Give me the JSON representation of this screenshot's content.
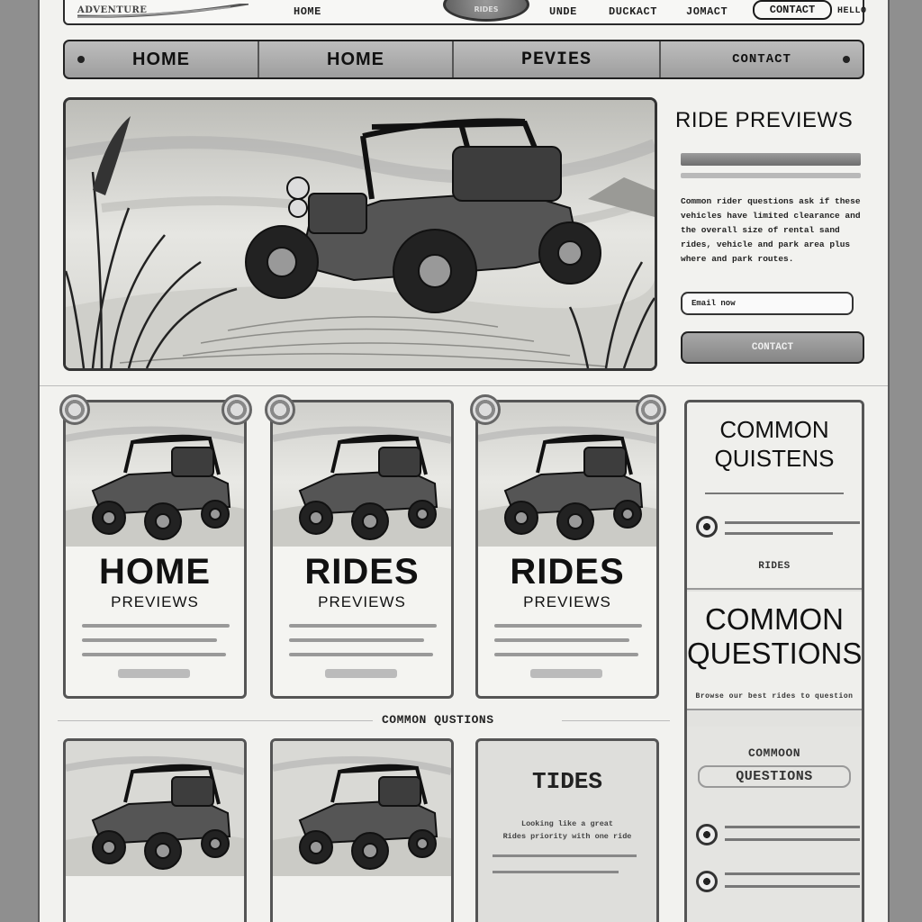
{
  "header": {
    "brand": "ADVENTURE",
    "links": [
      {
        "label": "HOME"
      },
      {
        "label": "UNDE"
      },
      {
        "label": "DUCKACT"
      },
      {
        "label": "JOMACT"
      }
    ],
    "contact_button": "CONTACT",
    "extra_label": "HELLO",
    "badge_label": "RIDES"
  },
  "nav": {
    "items": [
      {
        "label": "HOME"
      },
      {
        "label": "HOME"
      },
      {
        "label": "PEVIES"
      },
      {
        "label": "CONTACT"
      }
    ]
  },
  "side": {
    "title": "RIDE PREVIEWS",
    "paragraph": "Common rider questions ask if these vehicles have limited clearance and the overall size of rental sand rides, vehicle and park area plus where and park routes.",
    "input_placeholder": "Email now",
    "button_label": "CONTACT"
  },
  "cards": [
    {
      "title": "HOME",
      "subtitle": "PREVIEWS"
    },
    {
      "title": "RIDES",
      "subtitle": "PREVIEWS"
    },
    {
      "title": "RIDES",
      "subtitle": "PREVIEWS"
    }
  ],
  "mid_caption": "COMMON QUSTIONS",
  "right_column": {
    "q1_title": "COMMON QUISTENS",
    "rides_label": "RIDES",
    "q2_title": "COMMON QUESTIONS",
    "small_line": "Browse our best rides to question",
    "q3_title_top": "COMMOON",
    "q3_title_bottom": "QUESTIONS"
  },
  "bottom": {
    "card3_title": "TIDES",
    "card3_lines": [
      "Looking like a great",
      "Rides priority with one ride"
    ]
  }
}
